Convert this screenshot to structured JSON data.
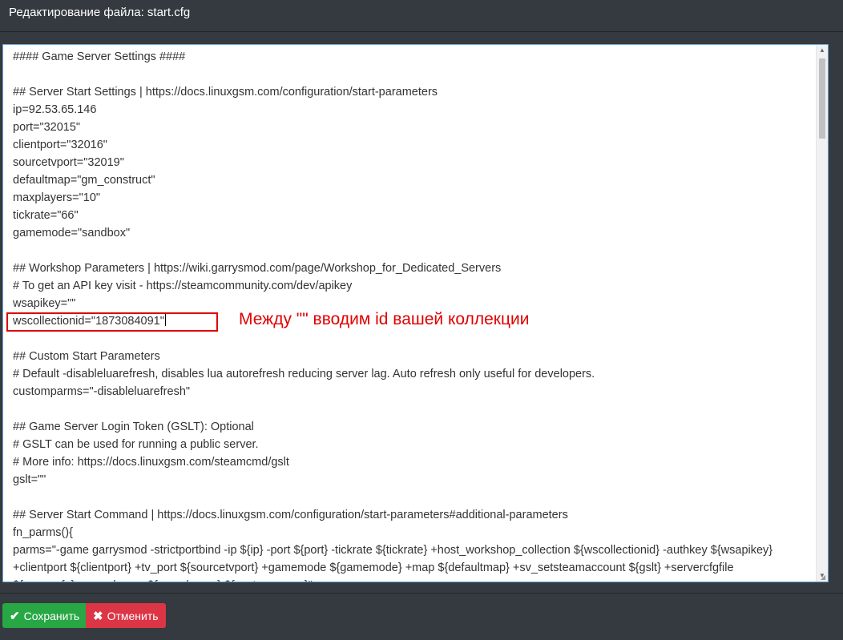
{
  "header": {
    "title": "Редактирование файла: start.cfg"
  },
  "editor": {
    "lines": [
      "#### Game Server Settings ####",
      "",
      "## Server Start Settings | https://docs.linuxgsm.com/configuration/start-parameters",
      "ip=92.53.65.146",
      "port=\"32015\"",
      "clientport=\"32016\"",
      "sourcetvport=\"32019\"",
      "defaultmap=\"gm_construct\"",
      "maxplayers=\"10\"",
      "tickrate=\"66\"",
      "gamemode=\"sandbox\"",
      "",
      "## Workshop Parameters | https://wiki.garrysmod.com/page/Workshop_for_Dedicated_Servers",
      "# To get an API key visit - https://steamcommunity.com/dev/apikey",
      "wsapikey=\"\"",
      "wscollectionid=\"1873084091\"",
      "",
      "## Custom Start Parameters",
      "# Default -disableluarefresh, disables lua autorefresh reducing server lag. Auto refresh only useful for developers.",
      "customparms=\"-disableluarefresh\"",
      "",
      "## Game Server Login Token (GSLT): Optional",
      "# GSLT can be used for running a public server.",
      "# More info: https://docs.linuxgsm.com/steamcmd/gslt",
      "gslt=\"\"",
      "",
      "## Server Start Command | https://docs.linuxgsm.com/configuration/start-parameters#additional-parameters",
      "fn_parms(){",
      "parms=\"-game garrysmod -strictportbind -ip ${ip} -port ${port} -tickrate ${tickrate} +host_workshop_collection ${wscollectionid} -authkey ${wsapikey}",
      "+clientport ${clientport} +tv_port ${sourcetvport} +gamemode ${gamemode} +map ${defaultmap} +sv_setsteamaccount ${gslt} +servercfgfile",
      "${servercfg} +maxplayers ${maxplayers} ${customparms}\""
    ]
  },
  "annotation": {
    "text": "Между \"\" вводим id вашей коллекции"
  },
  "footer": {
    "save_label": "Сохранить",
    "cancel_label": "Отменить"
  },
  "colors": {
    "background": "#343a40",
    "save": "#28a745",
    "cancel": "#dc3545",
    "annotation": "#e00000"
  },
  "icons": {
    "save": "check-icon",
    "cancel": "times-icon"
  }
}
